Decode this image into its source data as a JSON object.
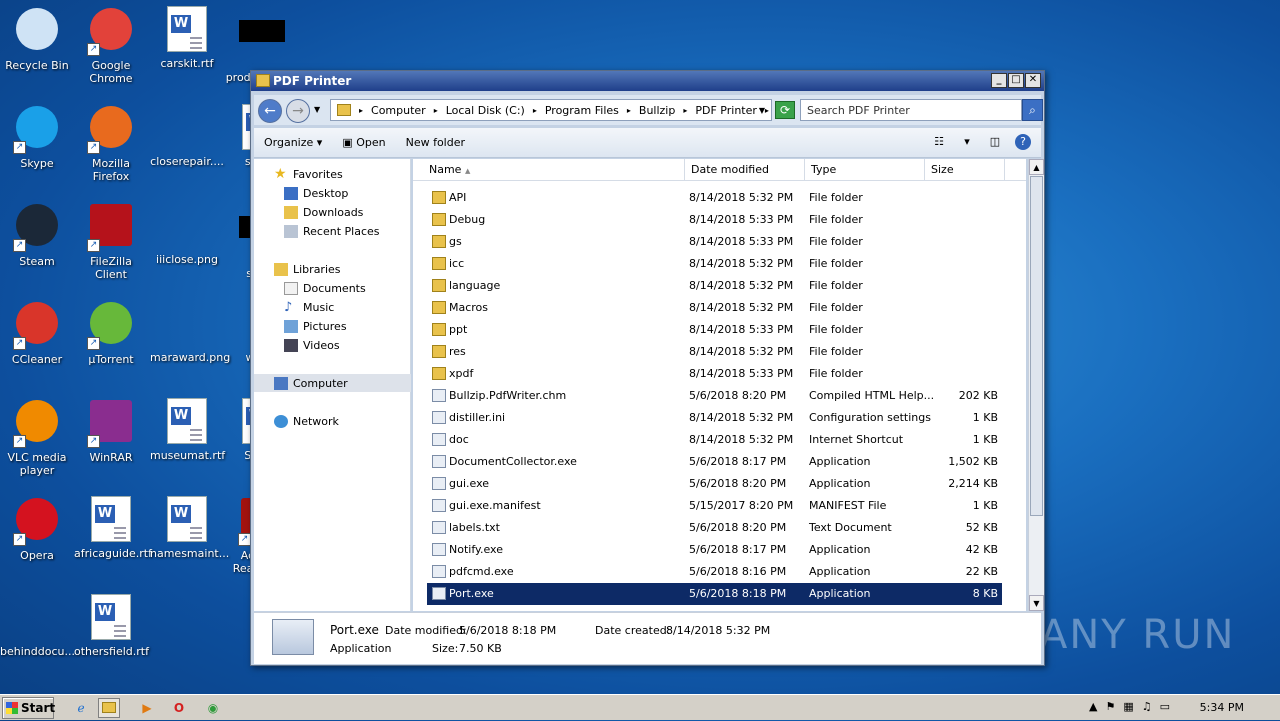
{
  "desktop": {
    "icons": [
      {
        "label": "Recycle Bin",
        "icon": "recycle-bin-icon"
      },
      {
        "label": "Google Chrome",
        "icon": "chrome-icon"
      },
      {
        "label": "carskit.rtf",
        "icon": "word-doc-icon"
      },
      {
        "label": "productioni...",
        "icon": "image-file-icon"
      },
      {
        "label": "Skype",
        "icon": "skype-icon"
      },
      {
        "label": "Mozilla Firefox",
        "icon": "firefox-icon"
      },
      {
        "label": "closerepair....",
        "icon": "blank-file-icon"
      },
      {
        "label": "stan...",
        "icon": "word-doc-icon"
      },
      {
        "label": "Steam",
        "icon": "steam-icon"
      },
      {
        "label": "FileZilla Client",
        "icon": "filezilla-icon"
      },
      {
        "label": "iiiclose.png",
        "icon": "blank-file-icon"
      },
      {
        "label": "stre...",
        "icon": "image-file-icon"
      },
      {
        "label": "CCleaner",
        "icon": "ccleaner-icon"
      },
      {
        "label": "µTorrent",
        "icon": "utorrent-icon"
      },
      {
        "label": "maraward.png",
        "icon": "blank-file-icon"
      },
      {
        "label": "who...",
        "icon": "blank-file-icon"
      },
      {
        "label": "VLC media player",
        "icon": "vlc-icon"
      },
      {
        "label": "WinRAR",
        "icon": "winrar-icon"
      },
      {
        "label": "museumat.rtf",
        "icon": "word-doc-icon"
      },
      {
        "label": "Setu...",
        "icon": "word-doc-icon"
      },
      {
        "label": "Opera",
        "icon": "opera-icon"
      },
      {
        "label": "africaguide.rtf",
        "icon": "word-doc-icon"
      },
      {
        "label": "namesmaint...",
        "icon": "word-doc-icon"
      },
      {
        "label": "Acrobat Reader DC",
        "icon": "acrobat-icon"
      },
      {
        "label": "behinddocu...",
        "icon": "blank-file-icon"
      },
      {
        "label": "othersfield.rtf",
        "icon": "word-doc-icon"
      }
    ]
  },
  "window": {
    "title": "PDF Printer",
    "breadcrumb": [
      "Computer",
      "Local Disk (C:)",
      "Program Files",
      "Bullzip",
      "PDF Printer"
    ],
    "search_placeholder": "Search PDF Printer",
    "toolbar": {
      "organize": "Organize",
      "open": "Open",
      "new_folder": "New folder"
    },
    "nav": {
      "favorites": "Favorites",
      "desktop": "Desktop",
      "downloads": "Downloads",
      "recent": "Recent Places",
      "libraries": "Libraries",
      "documents": "Documents",
      "music": "Music",
      "pictures": "Pictures",
      "videos": "Videos",
      "computer": "Computer",
      "network": "Network"
    },
    "columns": {
      "name": "Name",
      "date": "Date modified",
      "type": "Type",
      "size": "Size"
    },
    "files": [
      {
        "name": "API",
        "date": "8/14/2018 5:32 PM",
        "type": "File folder",
        "size": ""
      },
      {
        "name": "Debug",
        "date": "8/14/2018 5:33 PM",
        "type": "File folder",
        "size": ""
      },
      {
        "name": "gs",
        "date": "8/14/2018 5:33 PM",
        "type": "File folder",
        "size": ""
      },
      {
        "name": "icc",
        "date": "8/14/2018 5:32 PM",
        "type": "File folder",
        "size": ""
      },
      {
        "name": "language",
        "date": "8/14/2018 5:32 PM",
        "type": "File folder",
        "size": ""
      },
      {
        "name": "Macros",
        "date": "8/14/2018 5:32 PM",
        "type": "File folder",
        "size": ""
      },
      {
        "name": "ppt",
        "date": "8/14/2018 5:33 PM",
        "type": "File folder",
        "size": ""
      },
      {
        "name": "res",
        "date": "8/14/2018 5:32 PM",
        "type": "File folder",
        "size": ""
      },
      {
        "name": "xpdf",
        "date": "8/14/2018 5:33 PM",
        "type": "File folder",
        "size": ""
      },
      {
        "name": "Bullzip.PdfWriter.chm",
        "date": "5/6/2018 8:20 PM",
        "type": "Compiled HTML Help...",
        "size": "202 KB"
      },
      {
        "name": "distiller.ini",
        "date": "8/14/2018 5:32 PM",
        "type": "Configuration settings",
        "size": "1 KB"
      },
      {
        "name": "doc",
        "date": "8/14/2018 5:32 PM",
        "type": "Internet Shortcut",
        "size": "1 KB"
      },
      {
        "name": "DocumentCollector.exe",
        "date": "5/6/2018 8:17 PM",
        "type": "Application",
        "size": "1,502 KB"
      },
      {
        "name": "gui.exe",
        "date": "5/6/2018 8:20 PM",
        "type": "Application",
        "size": "2,214 KB"
      },
      {
        "name": "gui.exe.manifest",
        "date": "5/15/2017 8:20 PM",
        "type": "MANIFEST File",
        "size": "1 KB"
      },
      {
        "name": "labels.txt",
        "date": "5/6/2018 8:20 PM",
        "type": "Text Document",
        "size": "52 KB"
      },
      {
        "name": "Notify.exe",
        "date": "5/6/2018 8:17 PM",
        "type": "Application",
        "size": "42 KB"
      },
      {
        "name": "pdfcmd.exe",
        "date": "5/6/2018 8:16 PM",
        "type": "Application",
        "size": "22 KB"
      },
      {
        "name": "Port.exe",
        "date": "5/6/2018 8:18 PM",
        "type": "Application",
        "size": "8 KB"
      }
    ],
    "details": {
      "name": "Port.exe",
      "modified_label": "Date modified:",
      "modified": "5/6/2018 8:18 PM",
      "created_label": "Date created:",
      "created": "8/14/2018 5:32 PM",
      "type": "Application",
      "size_label": "Size:",
      "size": "7.50 KB"
    }
  },
  "taskbar": {
    "start": "Start",
    "clock": "5:34 PM"
  },
  "watermark": "ANY RUN"
}
